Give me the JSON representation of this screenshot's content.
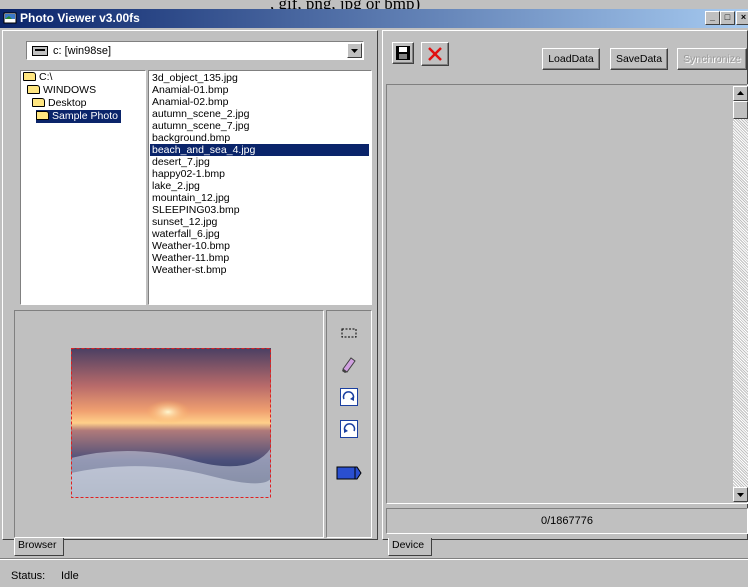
{
  "top_cropped_text": ", gif, png, jpg or bmp)",
  "window": {
    "title": "Photo Viewer v3.00fs",
    "controls": [
      "minimize-icon",
      "maximize-icon",
      "close-icon"
    ]
  },
  "browser": {
    "drive_selected": "c: [win98se]",
    "tree": [
      {
        "label": "C:\\",
        "level": 0
      },
      {
        "label": "WINDOWS",
        "level": 1
      },
      {
        "label": "Desktop",
        "level": 2
      },
      {
        "label": "Sample Photo",
        "level": 3,
        "selected": true
      }
    ],
    "files": [
      "3d_object_135.jpg",
      "Anamial-01.bmp",
      "Anamial-02.bmp",
      "autumn_scene_2.jpg",
      "autumn_scene_7.jpg",
      "background.bmp",
      "beach_and_sea_4.jpg",
      "desert_7.jpg",
      "happy02-1.bmp",
      "lake_2.jpg",
      "mountain_12.jpg",
      "SLEEPING03.bmp",
      "sunset_12.jpg",
      "waterfall_6.jpg",
      "Weather-10.bmp",
      "Weather-11.bmp",
      "Weather-st.bmp"
    ],
    "selected_file": "beach_and_sea_4.jpg",
    "tools": [
      "select-rect-icon",
      "eraser-icon",
      "rotate-right-icon",
      "rotate-left-icon",
      "send-to-device-icon"
    ],
    "tab_label": "Browser"
  },
  "device": {
    "toolbar": {
      "save_icon": "floppy-disk-icon",
      "delete_icon": "red-x-icon",
      "load_label": "LoadData",
      "save_label": "SaveData",
      "sync_label": "Synchronize"
    },
    "counter": "0/1867776",
    "tab_label": "Device"
  },
  "status": {
    "label": "Status:",
    "value": "Idle"
  },
  "colors": {
    "title_start": "#0a246a",
    "title_end": "#a6caf0",
    "selection": "#0a246a",
    "face": "#c0c0c0"
  }
}
